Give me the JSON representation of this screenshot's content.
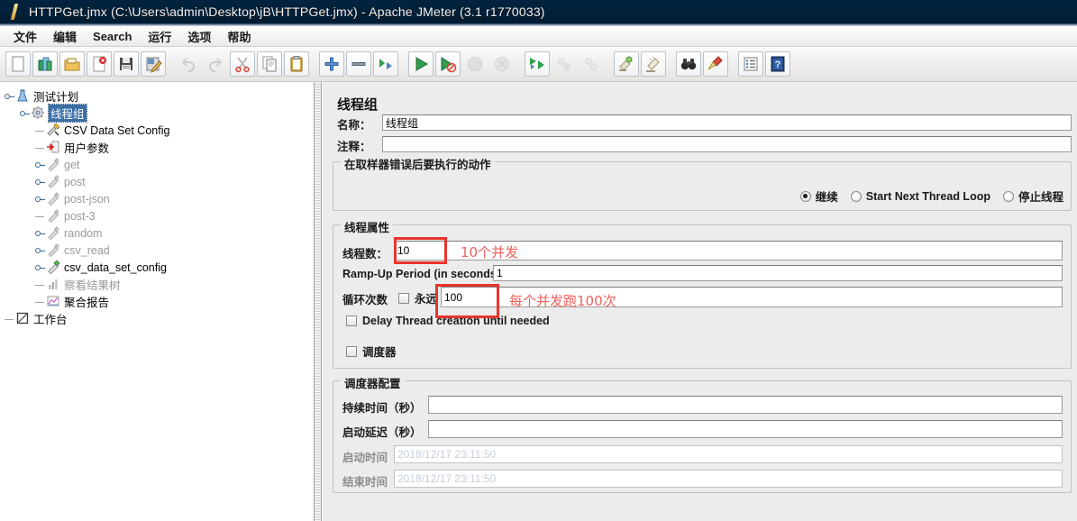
{
  "window": {
    "title": "HTTPGet.jmx (C:\\Users\\admin\\Desktop\\jB\\HTTPGet.jmx) - Apache JMeter (3.1 r1770033)",
    "icon": "jmeter-feather-icon"
  },
  "menu": {
    "items": [
      {
        "label": "文件",
        "name": "menu-file"
      },
      {
        "label": "编辑",
        "name": "menu-edit"
      },
      {
        "label": "Search",
        "name": "menu-search"
      },
      {
        "label": "运行",
        "name": "menu-run"
      },
      {
        "label": "选项",
        "name": "menu-options"
      },
      {
        "label": "帮助",
        "name": "menu-help"
      }
    ]
  },
  "toolbar": {
    "buttons": [
      {
        "name": "new-icon",
        "kind": "page",
        "enabled": true
      },
      {
        "name": "templates-icon",
        "kind": "templates",
        "enabled": true
      },
      {
        "name": "open-icon",
        "kind": "folder",
        "enabled": true
      },
      {
        "name": "close-icon",
        "kind": "page-close",
        "enabled": true
      },
      {
        "name": "save-icon",
        "kind": "floppy",
        "enabled": true
      },
      {
        "name": "save-as-icon",
        "kind": "save-as",
        "enabled": true
      },
      {
        "sep": true
      },
      {
        "name": "undo-icon",
        "kind": "undo",
        "enabled": false
      },
      {
        "name": "redo-icon",
        "kind": "redo",
        "enabled": false
      },
      {
        "name": "cut-icon",
        "kind": "scissors",
        "enabled": true
      },
      {
        "name": "copy-icon",
        "kind": "copy",
        "enabled": true
      },
      {
        "name": "paste-icon",
        "kind": "clipboard",
        "enabled": true
      },
      {
        "sep": true
      },
      {
        "name": "expand-all-icon",
        "kind": "plus",
        "enabled": true
      },
      {
        "name": "collapse-all-icon",
        "kind": "minus",
        "enabled": true
      },
      {
        "name": "toggle-icon",
        "kind": "toggle",
        "enabled": true
      },
      {
        "sep": true
      },
      {
        "name": "start-icon",
        "kind": "play",
        "enabled": true
      },
      {
        "name": "start-no-pauses-icon",
        "kind": "play-no-pause",
        "enabled": true
      },
      {
        "name": "stop-icon",
        "kind": "stop",
        "enabled": false
      },
      {
        "name": "shutdown-icon",
        "kind": "shutdown",
        "enabled": false
      },
      {
        "sep": true
      },
      {
        "name": "remote-start-all-icon",
        "kind": "remote-start",
        "enabled": true
      },
      {
        "name": "remote-stop-all-icon",
        "kind": "remote-stop",
        "enabled": false
      },
      {
        "name": "remote-shutdown-all-icon",
        "kind": "remote-shutdown",
        "enabled": false
      },
      {
        "sep": true
      },
      {
        "name": "clear-icon",
        "kind": "clear",
        "enabled": true
      },
      {
        "name": "clear-all-icon",
        "kind": "clear-all",
        "enabled": true
      },
      {
        "sep": true
      },
      {
        "name": "search-icon",
        "kind": "binoculars",
        "enabled": true
      },
      {
        "name": "reset-search-icon",
        "kind": "broom",
        "enabled": true
      },
      {
        "sep": true
      },
      {
        "name": "function-helper-icon",
        "kind": "list",
        "enabled": true
      },
      {
        "name": "help-icon",
        "kind": "help-book",
        "enabled": true
      }
    ]
  },
  "tree": {
    "nodes": [
      {
        "label": "测试计划",
        "depth": 0,
        "icon": "test-plan-icon",
        "handle": "knob",
        "dim": false,
        "selected": false
      },
      {
        "label": "线程组",
        "depth": 1,
        "icon": "thread-group-icon",
        "handle": "knob",
        "dim": false,
        "selected": true
      },
      {
        "label": "CSV Data Set Config",
        "depth": 2,
        "icon": "csv-config-icon",
        "handle": "dash",
        "dim": false,
        "selected": false
      },
      {
        "label": "用户参数",
        "depth": 2,
        "icon": "user-parameters-icon",
        "handle": "dash",
        "dim": false,
        "selected": false
      },
      {
        "label": "get",
        "depth": 2,
        "icon": "http-sampler-icon",
        "handle": "knob",
        "dim": true,
        "selected": false
      },
      {
        "label": "post",
        "depth": 2,
        "icon": "http-sampler-icon",
        "handle": "knob",
        "dim": true,
        "selected": false
      },
      {
        "label": "post-json",
        "depth": 2,
        "icon": "http-sampler-icon",
        "handle": "knob",
        "dim": true,
        "selected": false
      },
      {
        "label": "post-3",
        "depth": 2,
        "icon": "http-sampler-icon",
        "handle": "dash",
        "dim": true,
        "selected": false
      },
      {
        "label": "random",
        "depth": 2,
        "icon": "http-sampler-icon",
        "handle": "knob",
        "dim": true,
        "selected": false
      },
      {
        "label": "csv_read",
        "depth": 2,
        "icon": "http-sampler-icon",
        "handle": "knob",
        "dim": true,
        "selected": false
      },
      {
        "label": "csv_data_set_config",
        "depth": 2,
        "icon": "http-sampler-active-icon",
        "handle": "knob",
        "dim": false,
        "selected": false
      },
      {
        "label": "察看结果树",
        "depth": 2,
        "icon": "view-results-tree-icon",
        "handle": "dash",
        "dim": true,
        "selected": false
      },
      {
        "label": "聚合报告",
        "depth": 2,
        "icon": "aggregate-report-icon",
        "handle": "dash",
        "dim": false,
        "selected": false
      },
      {
        "label": "工作台",
        "depth": 0,
        "icon": "workbench-icon",
        "handle": "dash",
        "dim": false,
        "selected": false
      }
    ]
  },
  "panel": {
    "title": "线程组",
    "name_label": "名称：",
    "name_value": "线程组",
    "comment_label": "注释：",
    "comment_value": "",
    "on_error_group": "在取样器错误后要执行的动作",
    "on_error_options": [
      {
        "label": "继续",
        "selected": true,
        "name": "radio-continue"
      },
      {
        "label": "Start Next Thread Loop",
        "selected": false,
        "name": "radio-start-next-thread-loop"
      },
      {
        "label": "停止线程",
        "selected": false,
        "name": "radio-stop-thread"
      }
    ],
    "thread_props_group": "线程属性",
    "thread_count_label": "线程数：",
    "thread_count_value": "10",
    "ramp_up_label": "Ramp-Up Period (in seconds):",
    "ramp_up_value": "1",
    "loop_count_label": "循环次数",
    "forever_label": "永远",
    "forever_checked": false,
    "loop_count_value": "100",
    "delay_thread_label": "Delay Thread creation until needed",
    "delay_thread_checked": false,
    "scheduler_label": "调度器",
    "scheduler_checked": false,
    "scheduler_group": "调度器配置",
    "duration_label": "持续时间（秒）",
    "duration_value": "",
    "startup_delay_label": "启动延迟（秒）",
    "startup_delay_value": "",
    "start_time_label": "启动时间",
    "start_time_value": "2018/12/17 23:11:50",
    "end_time_label": "结束时间",
    "end_time_value": "2018/12/17 23:11:50"
  },
  "annotations": {
    "color": "#e8352c",
    "text_color": "#f0615c",
    "note_threads": "10个并发",
    "note_loops": "每个并发跑100次"
  }
}
